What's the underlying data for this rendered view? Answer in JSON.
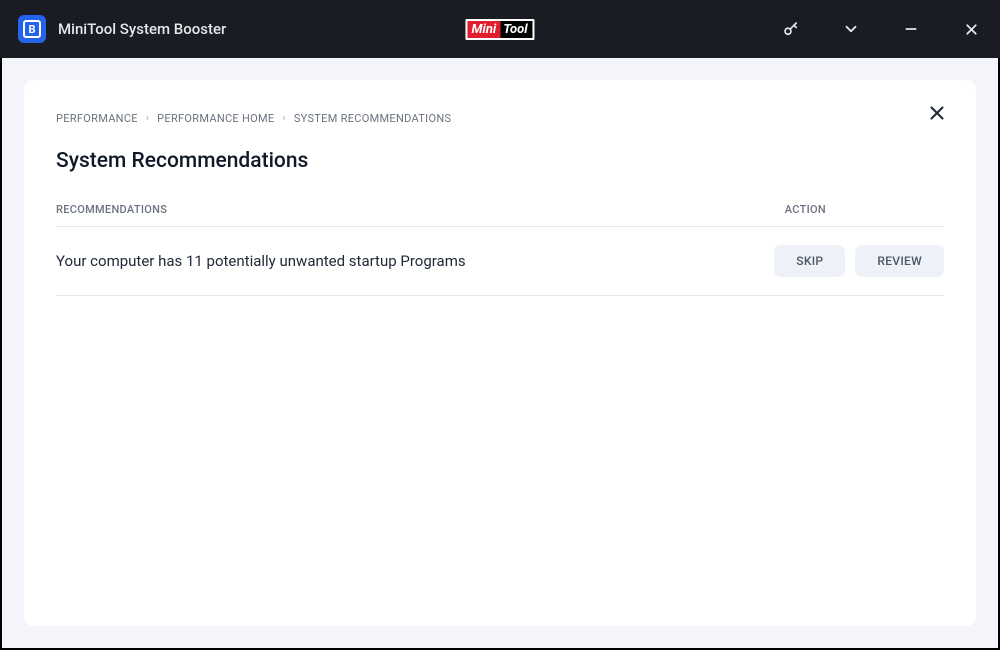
{
  "app": {
    "title": "MiniTool System Booster",
    "brand_left": "Mini",
    "brand_right": "Tool"
  },
  "breadcrumb": {
    "items": [
      "PERFORMANCE",
      "PERFORMANCE HOME",
      "SYSTEM RECOMMENDATIONS"
    ]
  },
  "page": {
    "title": "System Recommendations"
  },
  "table": {
    "headers": {
      "recommendations": "RECOMMENDATIONS",
      "action": "ACTION"
    },
    "rows": [
      {
        "text": "Your computer has 11 potentially unwanted startup Programs",
        "skip_label": "SKIP",
        "review_label": "REVIEW"
      }
    ]
  }
}
